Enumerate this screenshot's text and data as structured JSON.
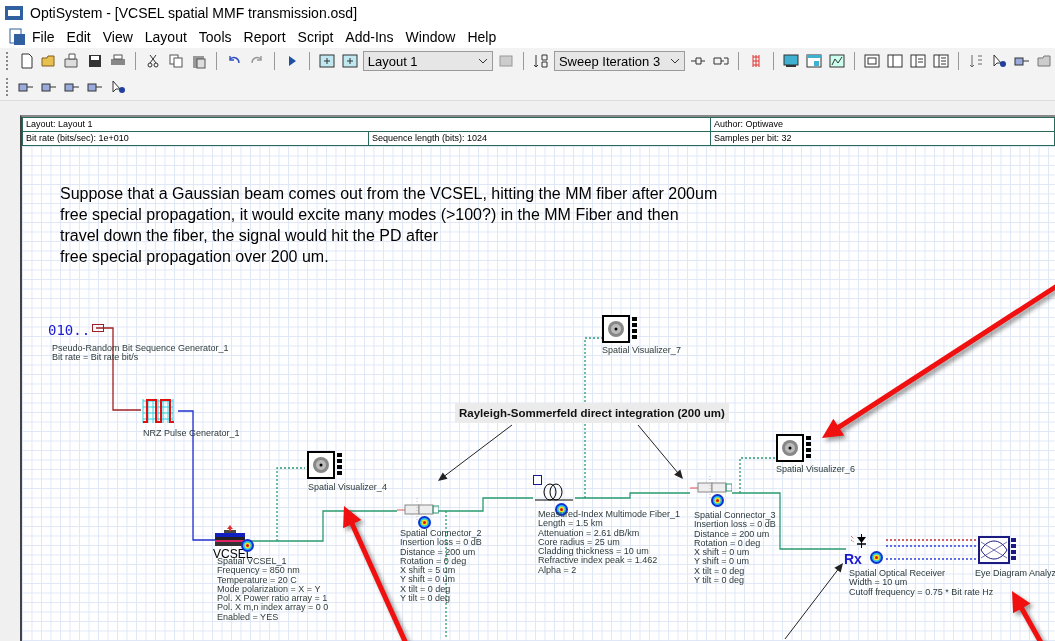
{
  "window": {
    "title": "OptiSystem - [VCSEL spatial MMF transmission.osd]"
  },
  "menu": [
    "File",
    "Edit",
    "View",
    "Layout",
    "Tools",
    "Report",
    "Script",
    "Add-Ins",
    "Window",
    "Help"
  ],
  "toolbar": {
    "layout_select": "Layout 1",
    "sweep_select": "Sweep Iteration 3"
  },
  "header": {
    "layout": "Layout: Layout 1",
    "author": "Author: Optiwave",
    "bit_rate": "Bit rate (bits/sec):  1e+010",
    "sequence_length": "Sequence length (bits):  1024",
    "samples_per_bit": "Samples per bit:  32"
  },
  "note": [
    "Suppose that a Gaussian beam comes out from the VCSEL, hitting the MM fiber after 200um",
    "free special propagation, it would excite many modes (>100?) in the MM Fiber and then",
    "travel down the fiber, the signal would hit the PD after",
    "free special propagation over 200 um."
  ],
  "callout": "Rayleigh-Sommerfeld direct integration (200 um)",
  "components": [
    {
      "kind": "prbs",
      "icon_text": "010..",
      "name": "Pseudo-Random Bit Sequence Generator_1",
      "params": [
        "Bit rate = Bit rate  bit/s"
      ]
    },
    {
      "kind": "nrz",
      "name": "NRZ Pulse Generator_1"
    },
    {
      "kind": "vcsel",
      "icon_text": "VCSEL",
      "name": "Spatial VCSEL_1",
      "params": [
        "Frequency = 850  nm",
        "Temperature = 20  C",
        "Mode polarization = X = Y",
        "Pol. X Power ratio array = 1",
        "Pol. X m,n index array =  0 0",
        "Enabled = YES"
      ]
    },
    {
      "kind": "visualizer",
      "name": "Spatial Visualizer_4"
    },
    {
      "kind": "connector",
      "name": "Spatial Connector_2",
      "params": [
        "Insertion loss = 0  dB",
        "Distance = 200  um",
        "Rotation = 0  deg",
        "X shift = 5  um",
        "Y shift = 0  um",
        "X tilt = 0  deg",
        "Y tilt = 0  deg"
      ]
    },
    {
      "kind": "visualizer",
      "name": "Spatial Visualizer_7"
    },
    {
      "kind": "fiber",
      "name": "Measured-Index Multimode Fiber_1",
      "params": [
        "Length = 1.5  km",
        "Attenuation = 2.61  dB/km",
        "Core radius = 25  um",
        "Cladding thickness = 10  um",
        "Refractive index peak = 1.462",
        "Alpha = 2"
      ]
    },
    {
      "kind": "connector",
      "name": "Spatial Connector_3",
      "params": [
        "Insertion loss = 0  dB",
        "Distance = 200  um",
        "Rotation = 0  deg",
        "X shift = 0  um",
        "Y shift = 0  um",
        "X tilt = 0  deg",
        "Y tilt = 0  deg"
      ]
    },
    {
      "kind": "visualizer",
      "name": "Spatial Visualizer_6"
    },
    {
      "kind": "receiver",
      "icon_text": "Rx",
      "name": "Spatial Optical Receiver",
      "params": [
        "Width = 10  um",
        "Cutoff frequency = 0.75 * Bit rate  Hz"
      ]
    },
    {
      "kind": "eye",
      "name": "Eye Diagram Analyz"
    }
  ]
}
